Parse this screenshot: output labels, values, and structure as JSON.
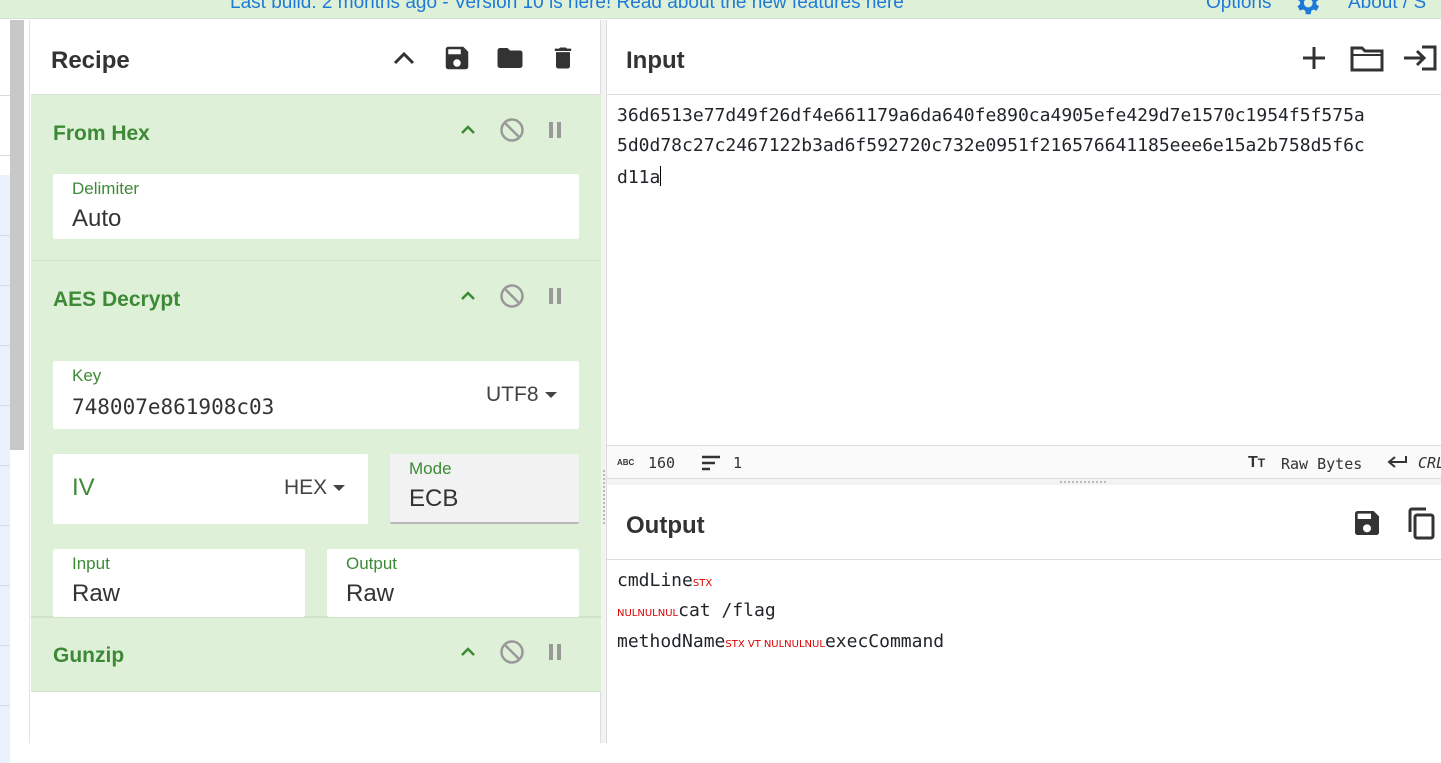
{
  "banner": {
    "left_text": "Last build: 2 months ago - Version 10 is here! Read about the new features here",
    "options": "Options",
    "about": "About / S"
  },
  "recipe": {
    "title": "Recipe",
    "operations": [
      {
        "name": "From Hex",
        "delimiter_label": "Delimiter",
        "delimiter_value": "Auto"
      },
      {
        "name": "AES Decrypt",
        "key_label": "Key",
        "key_value": "748007e861908c03",
        "key_encoding": "UTF8",
        "iv_label": "IV",
        "iv_encoding": "HEX",
        "mode_label": "Mode",
        "mode_value": "ECB",
        "input_label": "Input",
        "input_value": "Raw",
        "output_label": "Output",
        "output_value": "Raw"
      },
      {
        "name": "Gunzip"
      }
    ]
  },
  "input": {
    "title": "Input",
    "lines": [
      "36d6513e77d49f26df4e661179a6da640fe890ca4905efe429d7e1570c1954f5f575a",
      "5d0d78c27c2467122b3ad6f592720c732e0951f216576641185eee6e15a2b758d5f6c",
      "d11a"
    ],
    "stats": {
      "length": "160",
      "lines": "1",
      "encoding": "Raw Bytes",
      "eol": "CRL"
    }
  },
  "output": {
    "title": "Output",
    "line1_text": "cmdLine",
    "line1_ctl": "STX",
    "line2_ctl": "NULNULNUL",
    "line2_text": "cat /flag",
    "line3_text1": "methodName",
    "line3_ctl1": "STX VT",
    "line3_ctl2": "NULNULNUL",
    "line3_text2": "execCommand"
  }
}
